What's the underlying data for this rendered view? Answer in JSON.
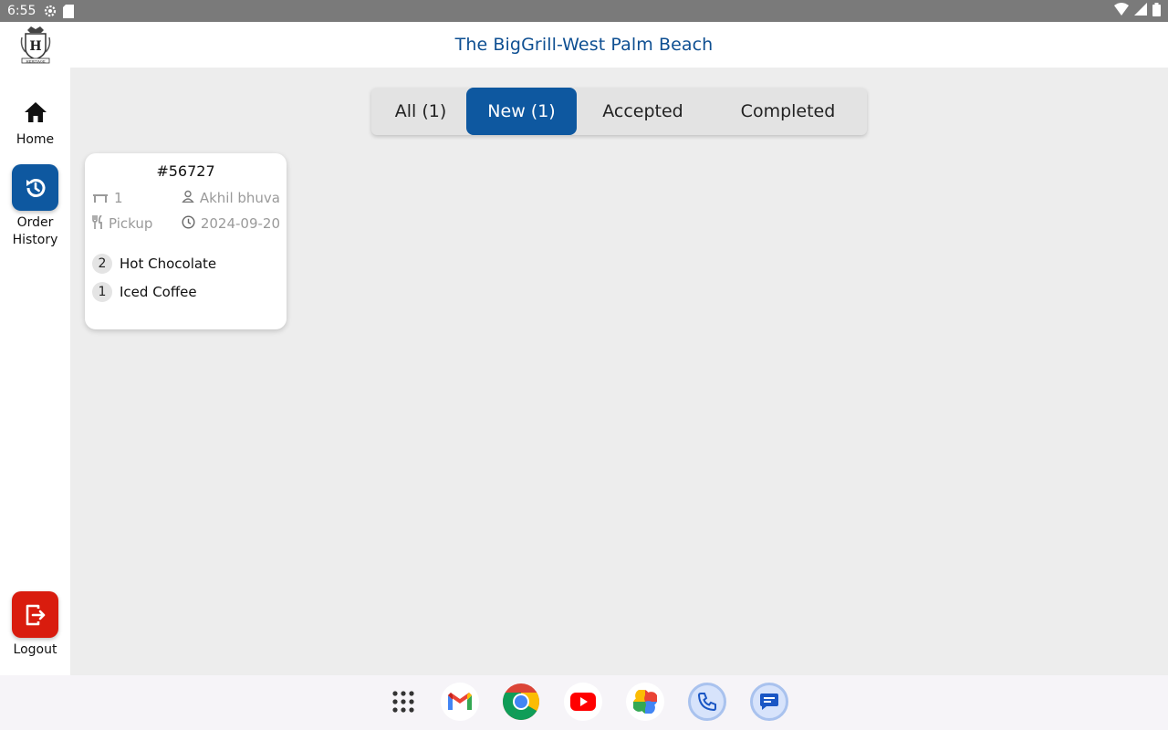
{
  "status_bar": {
    "time": "6:55",
    "icons": [
      "settings-icon",
      "sd-card-icon",
      "wifi-icon",
      "signal-icon",
      "battery-icon"
    ]
  },
  "header": {
    "logo_text": "HERITAGE",
    "title": "The BigGrill-West Palm Beach",
    "title_color": "#0e4f92"
  },
  "sidebar": {
    "items": [
      {
        "label": "Home",
        "icon": "home-icon"
      },
      {
        "label": "Order\nHistory",
        "icon": "history-icon",
        "color": "#0e58a0"
      },
      {
        "label": "Logout",
        "icon": "logout-icon",
        "color": "#d91c0e"
      }
    ]
  },
  "tabs": [
    {
      "label": "All (1)",
      "active": false
    },
    {
      "label": "New (1)",
      "active": true
    },
    {
      "label": "Accepted",
      "active": false
    },
    {
      "label": "Completed",
      "active": false
    }
  ],
  "accent_color": "#0e58a0",
  "orders": [
    {
      "number": "#56727",
      "table": "1",
      "customer": "Akhil bhuva",
      "type": "Pickup",
      "date": "2024-09-20",
      "items": [
        {
          "qty": "2",
          "name": "Hot Chocolate"
        },
        {
          "qty": "1",
          "name": "Iced Coffee"
        }
      ]
    }
  ],
  "dock": {
    "apps": [
      "apps-grid-icon",
      "gmail-icon",
      "chrome-icon",
      "youtube-icon",
      "photos-icon",
      "phone-icon",
      "messages-icon"
    ]
  }
}
